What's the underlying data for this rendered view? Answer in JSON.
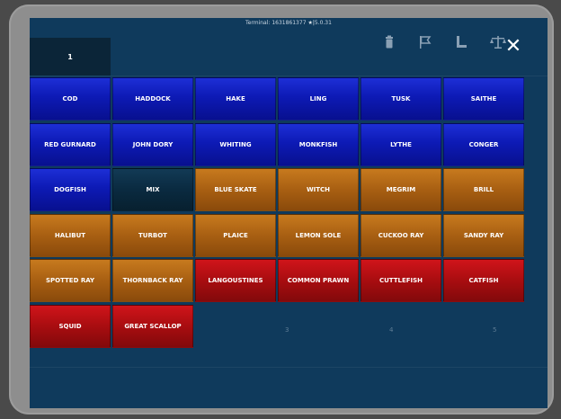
{
  "terminal": {
    "label": "Terminal: 1631861377",
    "separator": "|",
    "version": "5.0.31"
  },
  "quantity": {
    "value": "1"
  },
  "close_label": "✕",
  "icons": [
    "trash-icon",
    "flag-icon",
    "ruler-icon",
    "scale-icon"
  ],
  "species": [
    {
      "label": "COD",
      "color": "blue"
    },
    {
      "label": "HADDOCK",
      "color": "blue"
    },
    {
      "label": "HAKE",
      "color": "blue"
    },
    {
      "label": "LING",
      "color": "blue"
    },
    {
      "label": "TUSK",
      "color": "blue"
    },
    {
      "label": "SAITHE",
      "color": "blue"
    },
    {
      "label": "RED GURNARD",
      "color": "blue"
    },
    {
      "label": "JOHN DORY",
      "color": "blue"
    },
    {
      "label": "WHITING",
      "color": "blue"
    },
    {
      "label": "MONKFISH",
      "color": "blue"
    },
    {
      "label": "LYTHE",
      "color": "blue"
    },
    {
      "label": "CONGER",
      "color": "blue"
    },
    {
      "label": "DOGFISH",
      "color": "blue"
    },
    {
      "label": "MIX",
      "color": "mix"
    },
    {
      "label": "BLUE SKATE",
      "color": "orange"
    },
    {
      "label": "WITCH",
      "color": "orange"
    },
    {
      "label": "MEGRIM",
      "color": "orange"
    },
    {
      "label": "BRILL",
      "color": "orange"
    },
    {
      "label": "HALIBUT",
      "color": "orange"
    },
    {
      "label": "TURBOT",
      "color": "orange"
    },
    {
      "label": "PLAICE",
      "color": "orange"
    },
    {
      "label": "LEMON SOLE",
      "color": "orange"
    },
    {
      "label": "CUCKOO RAY",
      "color": "orange"
    },
    {
      "label": "SANDY RAY",
      "color": "orange"
    },
    {
      "label": "SPOTTED RAY",
      "color": "orange"
    },
    {
      "label": "THORNBACK RAY",
      "color": "orange"
    },
    {
      "label": "LANGOUSTINES",
      "color": "red"
    },
    {
      "label": "COMMON PRAWN",
      "color": "red"
    },
    {
      "label": "CUTTLEFISH",
      "color": "red"
    },
    {
      "label": "CATFISH",
      "color": "red"
    },
    {
      "label": "SQUID",
      "color": "red"
    },
    {
      "label": "GREAT SCALLOP",
      "color": "red"
    }
  ],
  "background_numbers": [
    "3",
    "4",
    "5"
  ],
  "colors": {
    "blue": "#0d1ab5",
    "orange": "#a85f12",
    "red": "#a80d10",
    "mix": "#0a2a40",
    "screen_bg": "#0f3a5c"
  }
}
